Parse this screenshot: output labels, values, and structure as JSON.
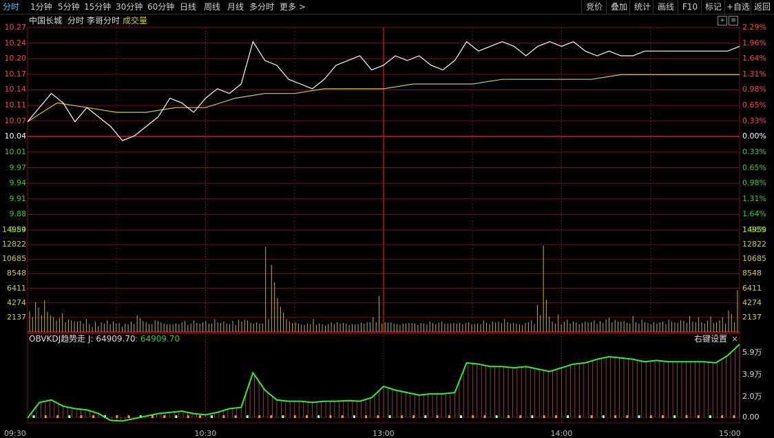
{
  "toolbar": {
    "tabs": [
      "分时",
      "1分钟",
      "5分钟",
      "15分钟",
      "30分钟",
      "60分钟",
      "日线",
      "周线",
      "月线",
      "多分时",
      "更多 >"
    ],
    "active_tab": "分时",
    "right_buttons": [
      "竞价",
      "叠加",
      "统计",
      "画线",
      "F10",
      "标记",
      "+自选",
      "返回"
    ]
  },
  "header": {
    "stock_name": "中国长城",
    "chart_type": "分时",
    "indicator_name": "李哥分时",
    "volume_label": "成交量"
  },
  "price_axis": {
    "left": [
      "10.27",
      "10.24",
      "10.20",
      "10.17",
      "10.14",
      "10.11",
      "10.07",
      "10.04",
      "10.01",
      "9.97",
      "9.94",
      "9.91",
      "9.88",
      "9.84"
    ],
    "right": [
      "2.29%",
      "1.96%",
      "1.64%",
      "1.31%",
      "0.98%",
      "0.65%",
      "0.33%",
      "0.00%",
      "0.33%",
      "0.65%",
      "0.98%",
      "1.31%",
      "1.64%",
      "1.96%"
    ],
    "base_price": 10.04
  },
  "volume_axis": [
    "14959",
    "12822",
    "10685",
    "8548",
    "6411",
    "4274",
    "2137"
  ],
  "indicator": {
    "title": "OBVKDJ趋势走",
    "j_label": "J: 64909.70",
    "j_value2": ": 64909.70",
    "settings_label": "右键设置",
    "close_label": "×",
    "axis": [
      "5.9万",
      "3.9万",
      "2.0万",
      "0.00"
    ]
  },
  "time_axis": [
    "09:30",
    "10:30",
    "13:00",
    "14:00",
    "15:00"
  ],
  "colors": {
    "grid_red": "#7a1010",
    "price_line": "#ffffff",
    "avg_line": "#d4c84a",
    "volume_bar": "#c8b43c",
    "obv_line": "#33ee33",
    "obv_bars": "#e0584a",
    "active_tab": "#4fc3f7"
  },
  "chart_data": {
    "type": "line",
    "price_series": {
      "name": "price",
      "x": [
        0,
        4,
        8,
        12,
        16,
        20,
        24,
        28,
        32,
        36,
        40,
        44,
        48,
        52,
        56,
        60,
        64,
        68,
        72,
        76,
        80,
        84,
        88,
        92,
        96,
        100,
        104,
        108,
        112,
        116,
        120,
        124,
        128,
        132,
        136,
        140,
        144,
        148,
        152,
        156,
        160,
        164,
        168,
        172,
        176,
        180,
        184,
        188,
        192,
        196,
        200,
        204,
        208,
        212,
        216,
        220,
        224,
        228,
        232,
        236,
        240
      ],
      "values": [
        10.07,
        10.1,
        10.13,
        10.11,
        10.07,
        10.1,
        10.08,
        10.06,
        10.03,
        10.04,
        10.06,
        10.08,
        10.12,
        10.11,
        10.09,
        10.12,
        10.14,
        10.13,
        10.15,
        10.24,
        10.2,
        10.19,
        10.16,
        10.15,
        10.14,
        10.16,
        10.19,
        10.2,
        10.21,
        10.18,
        10.19,
        10.21,
        10.2,
        10.21,
        10.19,
        10.18,
        10.2,
        10.24,
        10.22,
        10.23,
        10.24,
        10.23,
        10.21,
        10.23,
        10.24,
        10.23,
        10.24,
        10.22,
        10.21,
        10.22,
        10.21,
        10.21,
        10.22,
        10.22,
        10.22,
        10.22,
        10.22,
        10.22,
        10.22,
        10.22,
        10.23
      ]
    },
    "avg_series": {
      "name": "avg",
      "x": [
        0,
        10,
        20,
        30,
        40,
        50,
        60,
        70,
        80,
        90,
        100,
        110,
        120,
        130,
        140,
        150,
        160,
        170,
        180,
        190,
        200,
        210,
        220,
        230,
        240
      ],
      "values": [
        10.07,
        10.11,
        10.1,
        10.09,
        10.09,
        10.1,
        10.1,
        10.12,
        10.13,
        10.13,
        10.14,
        10.14,
        10.14,
        10.15,
        10.15,
        10.15,
        10.16,
        10.16,
        10.16,
        10.16,
        10.17,
        10.17,
        10.17,
        10.17,
        10.17
      ]
    },
    "volume": [
      3200,
      2300,
      4600,
      3800,
      2600,
      4900,
      3100,
      2600,
      2300,
      1800,
      2200,
      2900,
      1500,
      1900,
      1800,
      1600,
      1600,
      1700,
      1300,
      2000,
      1200,
      800,
      1600,
      900,
      1500,
      1300,
      1800,
      1200,
      1600,
      1300,
      1400,
      800,
      1300,
      1200,
      1600,
      1200,
      2600,
      2100,
      1700,
      1500,
      1200,
      1200,
      1800,
      1700,
      1500,
      1300,
      1200,
      1200,
      1200,
      1300,
      1200,
      1500,
      1700,
      1100,
      1300,
      1800,
      1400,
      1300,
      1500,
      1700,
      1300,
      1300,
      2000,
      1500,
      1400,
      1600,
      1300,
      1200,
      1700,
      1100,
      1900,
      1600,
      1900,
      1800,
      1400,
      1300,
      1500,
      1300,
      1300,
      13200,
      2000,
      10400,
      7700,
      5200,
      3900,
      3000,
      2000,
      1600,
      1400,
      1500,
      1300,
      1200,
      1100,
      1300,
      1200,
      2000,
      1100,
      1300,
      1200,
      1000,
      1200,
      1500,
      1200,
      1500,
      1300,
      1400,
      1300,
      1100,
      1200,
      1200,
      1200,
      1500,
      1300,
      1500,
      1500,
      2300,
      1500,
      5600,
      1300,
      1500,
      1400,
      1500,
      1300,
      1200,
      1100,
      1300,
      1300,
      1400,
      1400,
      1300,
      1100,
      1400,
      1300,
      1200,
      1600,
      1400,
      1200,
      1500,
      1600,
      1300,
      1300,
      1300,
      1400,
      1300,
      1400,
      1200,
      1400,
      1500,
      1200,
      1200,
      1300,
      1200,
      1800,
      1400,
      1200,
      1600,
      1500,
      1600,
      1400,
      2000,
      1500,
      1300,
      1400,
      1300,
      1200,
      1100,
      1400,
      1500,
      1800,
      1200,
      4200,
      2600,
      13400,
      5000,
      2400,
      1600,
      1300,
      2700,
      1200,
      1600,
      1900,
      1300,
      1600,
      1500,
      1200,
      1400,
      1600,
      1500,
      1500,
      1800,
      1200,
      1700,
      1400,
      1900,
      2200,
      1500,
      1900,
      1600,
      1600,
      1700,
      1400,
      1300,
      2500,
      1500,
      1300,
      1900,
      1500,
      1400,
      1200,
      1500,
      1300,
      1500,
      1600,
      1200,
      1900,
      1600,
      1500,
      1400,
      1800,
      1700,
      1400,
      2500,
      1600,
      1500,
      2300,
      1500,
      1300,
      1800,
      2400,
      1400,
      1500,
      1800,
      2300,
      1300,
      3300,
      2800,
      1500,
      6500
    ],
    "obv_series": {
      "name": "OBVKDJ",
      "x": [
        0,
        4,
        8,
        12,
        16,
        20,
        24,
        28,
        32,
        36,
        40,
        44,
        48,
        52,
        56,
        60,
        64,
        68,
        72,
        76,
        80,
        84,
        88,
        92,
        96,
        100,
        104,
        108,
        112,
        116,
        120,
        124,
        128,
        132,
        136,
        140,
        144,
        148,
        152,
        156,
        160,
        164,
        168,
        172,
        176,
        180,
        184,
        188,
        192,
        196,
        200,
        204,
        208,
        212,
        216,
        220,
        224,
        228,
        232,
        236,
        240
      ],
      "values": [
        -500,
        12000,
        14000,
        9000,
        7000,
        6000,
        3000,
        -2500,
        -3000,
        -1000,
        1000,
        3000,
        4000,
        5000,
        3000,
        2000,
        4000,
        7000,
        8000,
        36000,
        22000,
        14000,
        13000,
        13000,
        12000,
        13000,
        13000,
        13500,
        13000,
        16000,
        25000,
        22000,
        20000,
        18000,
        19000,
        19000,
        20000,
        44000,
        43000,
        41000,
        41000,
        40000,
        41000,
        39000,
        37000,
        40000,
        43000,
        44000,
        47000,
        49000,
        48000,
        47000,
        45000,
        46000,
        45000,
        45000,
        45000,
        45000,
        44000,
        50000,
        59000
      ]
    },
    "obv_ylim": [
      -5000,
      59000
    ],
    "ylim": [
      9.84,
      10.27
    ],
    "ylabel": "",
    "xlabel": ""
  }
}
